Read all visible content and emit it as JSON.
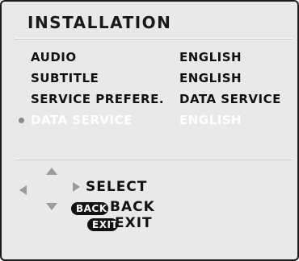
{
  "screen": {
    "title": "INSTALLATION"
  },
  "menu": {
    "rows": [
      {
        "label": "AUDIO",
        "value": "ENGLISH",
        "selected": false
      },
      {
        "label": "SUBTITLE",
        "value": "ENGLISH",
        "selected": false
      },
      {
        "label": "SERVICE PREFERE.",
        "value": "DATA SERVICE",
        "selected": false
      },
      {
        "label": "DATA SERVICE",
        "value": "ENGLISH",
        "selected": true
      }
    ]
  },
  "nav": {
    "select_label": "SELECT",
    "back_key": "BACK",
    "back_label": "BACK",
    "exit_key": "EXIT",
    "exit_label": "EXIT",
    "icons": [
      "arrow-up-icon",
      "arrow-down-icon",
      "arrow-left-icon",
      "arrow-right-icon"
    ]
  },
  "colors": {
    "background": "#e9e9e9",
    "text": "#111111",
    "selected_text": "#ffffff",
    "arrow": "#9a9a9a",
    "bullet": "#8a8a8a"
  }
}
